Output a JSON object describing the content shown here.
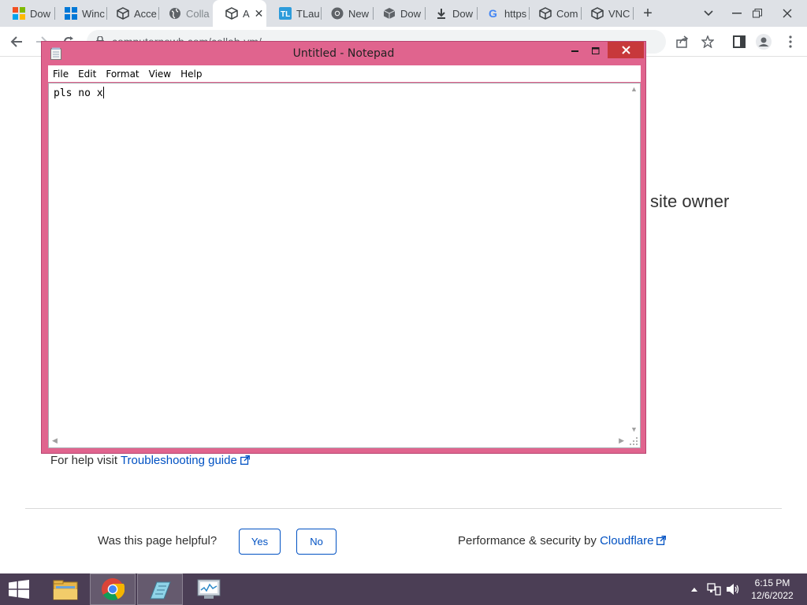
{
  "browser": {
    "tabs": [
      {
        "title": "Dow",
        "icon": "windows-logo-icon"
      },
      {
        "title": "Winc",
        "icon": "windows-blue-icon"
      },
      {
        "title": "Acce",
        "icon": "cube-icon"
      },
      {
        "title": "Colla",
        "icon": "globe-icon"
      },
      {
        "title": "A",
        "icon": "cube-icon",
        "active": true
      },
      {
        "title": "TLau",
        "icon": "tl-icon"
      },
      {
        "title": "New",
        "icon": "chrome-icon"
      },
      {
        "title": "Dow",
        "icon": "box-icon"
      },
      {
        "title": "Dow",
        "icon": "download-icon"
      },
      {
        "title": "https",
        "icon": "google-icon"
      },
      {
        "title": "Com",
        "icon": "cube-icon"
      },
      {
        "title": "VNC",
        "icon": "cube-icon"
      }
    ],
    "new_tab": "+",
    "url": "computernewb.com/collab-vm/"
  },
  "page": {
    "site_owner": "site owner",
    "help_prefix": "For help visit ",
    "help_link": "Troubleshooting guide",
    "helpful_question": "Was this page helpful?",
    "yes": "Yes",
    "no": "No",
    "perf_prefix": "Performance & security by ",
    "perf_link": "Cloudflare"
  },
  "notepad": {
    "title": "Untitled - Notepad",
    "menu": [
      "File",
      "Edit",
      "Format",
      "View",
      "Help"
    ],
    "content": "pls no x"
  },
  "taskbar": {
    "apps": [
      "file-explorer-icon",
      "chrome-icon",
      "notepad-icon",
      "task-manager-icon"
    ],
    "time": "6:15 PM",
    "date": "12/6/2022"
  },
  "colors": {
    "notepad_frame": "#e0648e",
    "close_button": "#c7383b",
    "link": "#0051c3",
    "taskbar": "#4b3e55"
  }
}
